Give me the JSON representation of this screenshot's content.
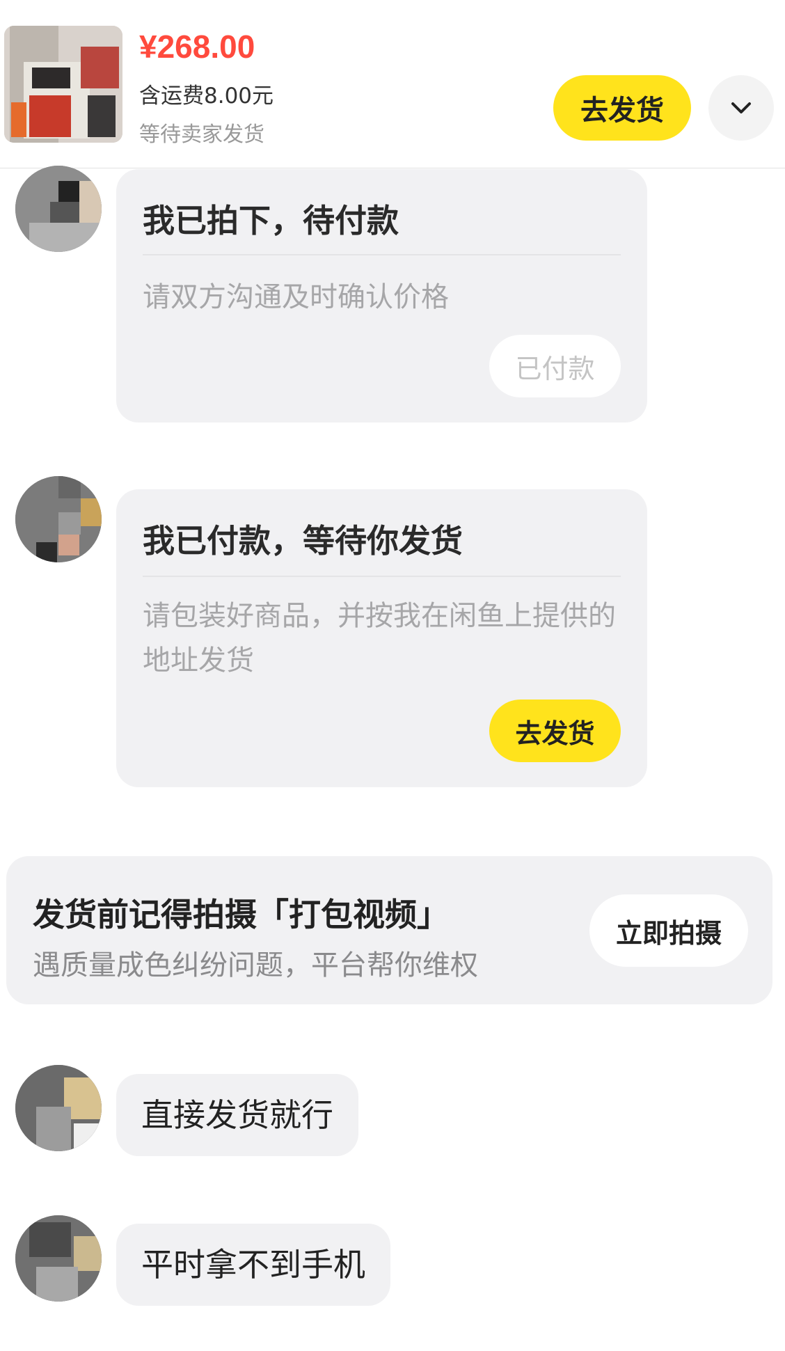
{
  "header": {
    "price": "¥268.00",
    "shipping": "含运费8.00元",
    "status": "等待卖家发货",
    "ship_button": "去发货",
    "expand_icon": "chevron-down-icon"
  },
  "cards": [
    {
      "title": "我已拍下，待付款",
      "desc": "请双方沟通及时确认价格",
      "button": "已付款"
    },
    {
      "title": "我已付款，等待你发货",
      "desc": "请包装好商品，并按我在闲鱼上提供的地址发货",
      "button": "去发货"
    }
  ],
  "banner": {
    "title": "发货前记得拍摄「打包视频」",
    "subtitle": "遇质量成色纠纷问题，平台帮你维权",
    "button": "立即拍摄"
  },
  "messages": [
    "直接发货就行",
    "平时拿不到手机"
  ],
  "colors": {
    "price": "#ff4a3d",
    "accent_yellow": "#ffe31c",
    "bubble_bg": "#f1f1f3"
  }
}
